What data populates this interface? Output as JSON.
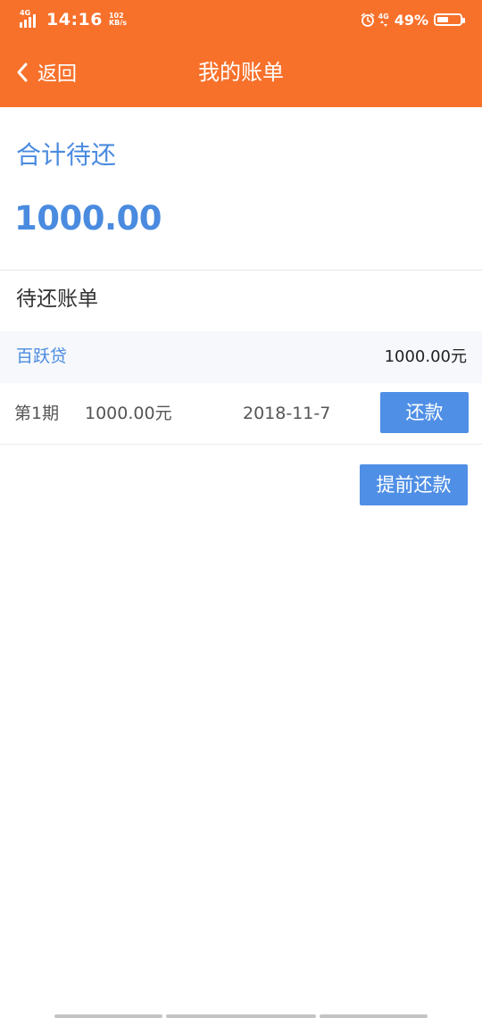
{
  "status_bar": {
    "network_left": "4G",
    "time": "14:16",
    "speed_value": "102",
    "speed_unit": "KB/s",
    "network_right": "4G",
    "battery_percent": "49%",
    "battery_level": 0.49,
    "icons": [
      "signal-icon",
      "alarm-icon",
      "battery-icon"
    ]
  },
  "header": {
    "back_label": "返回",
    "title": "我的账单",
    "background_color": "#f7712b"
  },
  "summary": {
    "label": "合计待还",
    "amount": "1000.00",
    "accent_color": "#4a8be0"
  },
  "bills": {
    "section_title": "待还账单",
    "lender": {
      "name": "百跃贷",
      "total": "1000.00元"
    },
    "installments": [
      {
        "period": "第1期",
        "amount": "1000.00元",
        "due_date": "2018-11-7",
        "action_label": "还款"
      }
    ],
    "early_repay_label": "提前还款",
    "button_color": "#4f8fe6"
  }
}
